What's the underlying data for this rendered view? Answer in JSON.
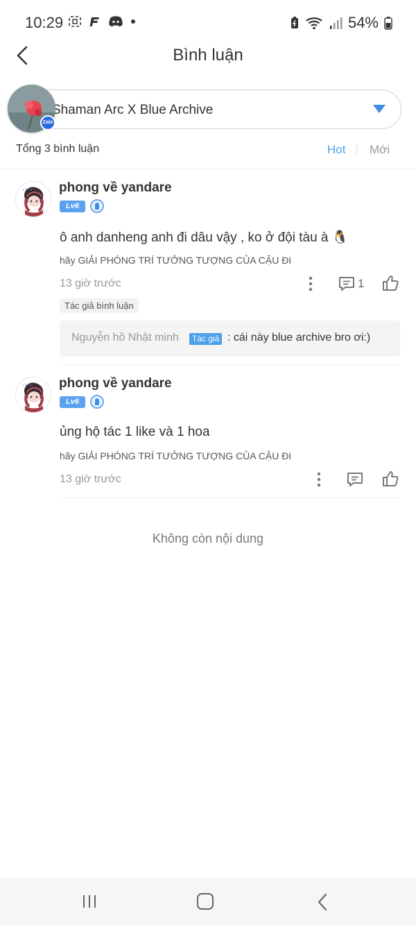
{
  "status_bar": {
    "time": "10:29",
    "battery": "54%"
  },
  "header": {
    "title": "Bình luận"
  },
  "story": {
    "name": "Shaman Arc X Blue Archive",
    "avatar_badge": "Zalo"
  },
  "sort": {
    "total": "Tổng 3 bình luận",
    "hot": "Hot",
    "new": "Mới"
  },
  "comments": [
    {
      "user": "phong về yandare",
      "level": "Lv6",
      "text": "ô anh danheng anh đi dâu vậy , ko ở đội tàu à 🐧",
      "signature": "hãy GIẢI PHÓNG TRÍ TƯỞNG TƯỢNG CỦA CẬU ĐI",
      "time": "13 giờ trước",
      "reply_count": "1",
      "author_tag": "Tác giả bình luận",
      "reply": {
        "name": "Nguyễn hồ Nhật minh",
        "tag": "Tác giả",
        "text": ": cái này blue archive bro ơi:)"
      }
    },
    {
      "user": "phong về yandare",
      "level": "Lv6",
      "text": "ủng hộ tác 1 like và 1 hoa",
      "signature": "hãy GIẢI PHÓNG TRÍ TƯỞNG TƯỢNG CỦA CẬU ĐI",
      "time": "13 giờ trước"
    }
  ],
  "footer": {
    "end_text": "Không còn nội dung"
  },
  "colors": {
    "accent": "#4a9fe8",
    "level_badge": "#5aa2ef"
  }
}
